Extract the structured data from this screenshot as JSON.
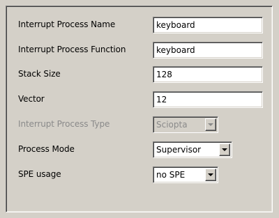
{
  "form": {
    "interrupt_name": {
      "label": "Interrupt Process Name",
      "value": "keyboard"
    },
    "interrupt_function": {
      "label": "Interrupt Process Function",
      "value": "keyboard"
    },
    "stack_size": {
      "label": "Stack Size",
      "value": "128"
    },
    "vector": {
      "label": "Vector",
      "value": "12"
    },
    "interrupt_type": {
      "label": "Interrupt Process Type",
      "value": "Sciopta",
      "disabled": true
    },
    "process_mode": {
      "label": "Process Mode",
      "value": "Supervisor"
    },
    "spe_usage": {
      "label": "SPE usage",
      "value": "no SPE"
    }
  },
  "icons": {
    "dropdown_arrow": "chevron-down-icon"
  }
}
